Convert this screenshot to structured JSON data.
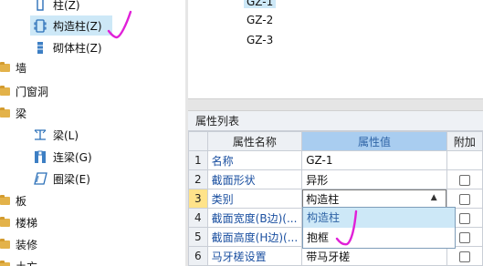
{
  "tree": {
    "items": [
      {
        "label": "柱(Z)",
        "kind": "column"
      },
      {
        "label": "构造柱(Z)",
        "kind": "construct-column",
        "selected": true
      },
      {
        "label": "砌体柱(Z)",
        "kind": "masonry-column"
      },
      {
        "label": "墙",
        "kind": "folder"
      },
      {
        "label": "门窗洞",
        "kind": "folder"
      },
      {
        "label": "梁",
        "kind": "folder"
      },
      {
        "label": "梁(L)",
        "kind": "beam"
      },
      {
        "label": "连梁(G)",
        "kind": "link-beam"
      },
      {
        "label": "圈梁(E)",
        "kind": "ring-beam"
      },
      {
        "label": "板",
        "kind": "folder"
      },
      {
        "label": "楼梯",
        "kind": "folder"
      },
      {
        "label": "装修",
        "kind": "folder"
      },
      {
        "label": "土方",
        "kind": "folder"
      }
    ]
  },
  "component_list": {
    "items": [
      "GZ-1",
      "GZ-2",
      "GZ-3"
    ],
    "selected_index": 0
  },
  "properties": {
    "title": "属性列表",
    "headers": {
      "name": "属性名称",
      "value": "属性值",
      "extra": "附加"
    },
    "rows": [
      {
        "num": "1",
        "name": "名称",
        "value": "GZ-1",
        "has_checkbox": false
      },
      {
        "num": "2",
        "name": "截面形状",
        "value": "异形",
        "has_checkbox": true
      },
      {
        "num": "3",
        "name": "类别",
        "value": "构造柱",
        "has_checkbox": true,
        "active": true
      },
      {
        "num": "4",
        "name": "截面宽度(B边)(...",
        "value": "",
        "has_checkbox": true
      },
      {
        "num": "5",
        "name": "截面高度(H边)(...",
        "value": "",
        "has_checkbox": true
      },
      {
        "num": "6",
        "name": "马牙槎设置",
        "value": "带马牙槎",
        "has_checkbox": true
      }
    ],
    "dropdown": {
      "options": [
        "构造柱",
        "抱框"
      ],
      "selected_index": 0
    }
  },
  "colors": {
    "selection": "#cde8f7",
    "header_highlight": "#a9cdf0",
    "active_row": "#ffe38a",
    "pen_mark": "#e020d8"
  }
}
